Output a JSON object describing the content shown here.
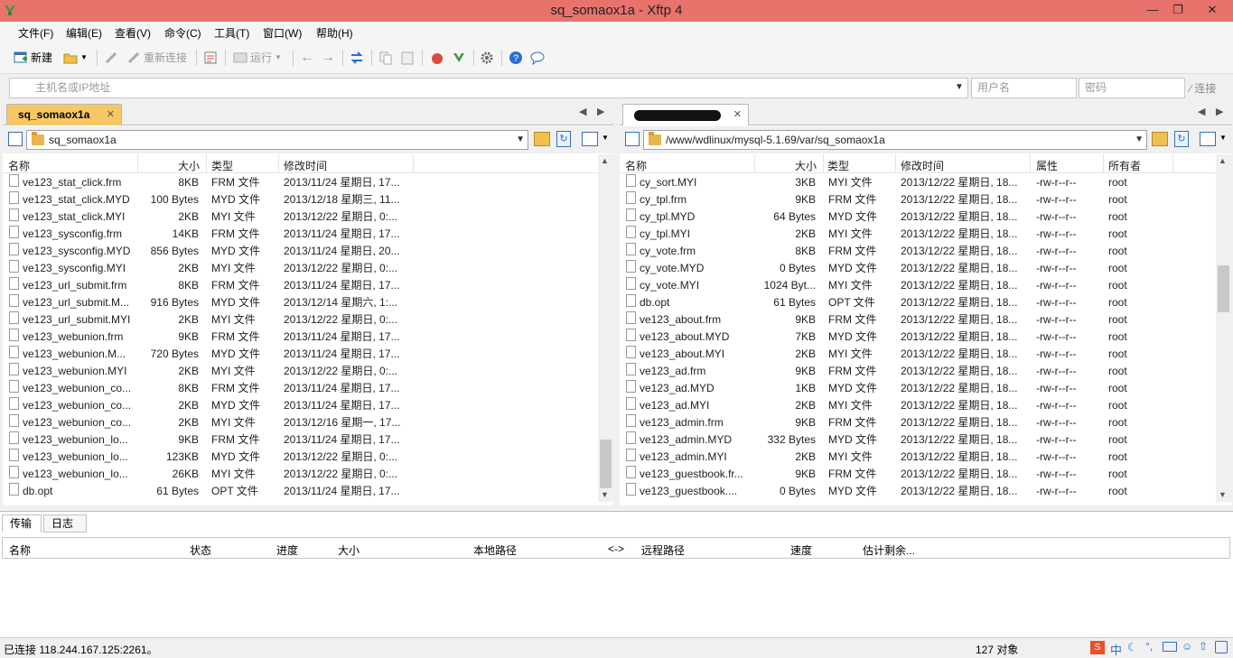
{
  "window": {
    "title": "sq_somaox1a - Xftp 4"
  },
  "menu": [
    "文件(F)",
    "编辑(E)",
    "查看(V)",
    "命令(C)",
    "工具(T)",
    "窗口(W)",
    "帮助(H)"
  ],
  "toolbar": {
    "new_label": "新建",
    "reconnect_label": "重新连接",
    "run_label": "运行"
  },
  "address": {
    "host_placeholder": "主机名或IP地址",
    "user_placeholder": "用户名",
    "password_placeholder": "密码",
    "connect_label": "连接"
  },
  "left": {
    "tab": "sq_somaox1a",
    "path": "sq_somaox1a",
    "columns": [
      "名称",
      "大小",
      "类型",
      "修改时间"
    ],
    "files": [
      [
        "ve123_stat_click.frm",
        "8KB",
        "FRM 文件",
        "2013/11/24 星期日, 17..."
      ],
      [
        "ve123_stat_click.MYD",
        "100 Bytes",
        "MYD 文件",
        "2013/12/18 星期三, 11..."
      ],
      [
        "ve123_stat_click.MYI",
        "2KB",
        "MYI 文件",
        "2013/12/22 星期日, 0:..."
      ],
      [
        "ve123_sysconfig.frm",
        "14KB",
        "FRM 文件",
        "2013/11/24 星期日, 17..."
      ],
      [
        "ve123_sysconfig.MYD",
        "856 Bytes",
        "MYD 文件",
        "2013/11/24 星期日, 20..."
      ],
      [
        "ve123_sysconfig.MYI",
        "2KB",
        "MYI 文件",
        "2013/12/22 星期日, 0:..."
      ],
      [
        "ve123_url_submit.frm",
        "8KB",
        "FRM 文件",
        "2013/11/24 星期日, 17..."
      ],
      [
        "ve123_url_submit.M...",
        "916 Bytes",
        "MYD 文件",
        "2013/12/14 星期六, 1:..."
      ],
      [
        "ve123_url_submit.MYI",
        "2KB",
        "MYI 文件",
        "2013/12/22 星期日, 0:..."
      ],
      [
        "ve123_webunion.frm",
        "9KB",
        "FRM 文件",
        "2013/11/24 星期日, 17..."
      ],
      [
        "ve123_webunion.M...",
        "720 Bytes",
        "MYD 文件",
        "2013/11/24 星期日, 17..."
      ],
      [
        "ve123_webunion.MYI",
        "2KB",
        "MYI 文件",
        "2013/12/22 星期日, 0:..."
      ],
      [
        "ve123_webunion_co...",
        "8KB",
        "FRM 文件",
        "2013/11/24 星期日, 17..."
      ],
      [
        "ve123_webunion_co...",
        "2KB",
        "MYD 文件",
        "2013/11/24 星期日, 17..."
      ],
      [
        "ve123_webunion_co...",
        "2KB",
        "MYI 文件",
        "2013/12/16 星期一, 17..."
      ],
      [
        "ve123_webunion_lo...",
        "9KB",
        "FRM 文件",
        "2013/11/24 星期日, 17..."
      ],
      [
        "ve123_webunion_lo...",
        "123KB",
        "MYD 文件",
        "2013/12/22 星期日, 0:..."
      ],
      [
        "ve123_webunion_lo...",
        "26KB",
        "MYI 文件",
        "2013/12/22 星期日, 0:..."
      ],
      [
        "db.opt",
        "61 Bytes",
        "OPT 文件",
        "2013/11/24 星期日, 17..."
      ]
    ]
  },
  "right": {
    "path": "/www/wdlinux/mysql-5.1.69/var/sq_somaox1a",
    "columns": [
      "名称",
      "大小",
      "类型",
      "修改时间",
      "属性",
      "所有者"
    ],
    "files": [
      [
        "cy_sort.MYI",
        "3KB",
        "MYI 文件",
        "2013/12/22 星期日, 18...",
        "-rw-r--r--",
        "root"
      ],
      [
        "cy_tpl.frm",
        "9KB",
        "FRM 文件",
        "2013/12/22 星期日, 18...",
        "-rw-r--r--",
        "root"
      ],
      [
        "cy_tpl.MYD",
        "64 Bytes",
        "MYD 文件",
        "2013/12/22 星期日, 18...",
        "-rw-r--r--",
        "root"
      ],
      [
        "cy_tpl.MYI",
        "2KB",
        "MYI 文件",
        "2013/12/22 星期日, 18...",
        "-rw-r--r--",
        "root"
      ],
      [
        "cy_vote.frm",
        "8KB",
        "FRM 文件",
        "2013/12/22 星期日, 18...",
        "-rw-r--r--",
        "root"
      ],
      [
        "cy_vote.MYD",
        "0 Bytes",
        "MYD 文件",
        "2013/12/22 星期日, 18...",
        "-rw-r--r--",
        "root"
      ],
      [
        "cy_vote.MYI",
        "1024 Byt...",
        "MYI 文件",
        "2013/12/22 星期日, 18...",
        "-rw-r--r--",
        "root"
      ],
      [
        "db.opt",
        "61 Bytes",
        "OPT 文件",
        "2013/12/22 星期日, 18...",
        "-rw-r--r--",
        "root"
      ],
      [
        "ve123_about.frm",
        "9KB",
        "FRM 文件",
        "2013/12/22 星期日, 18...",
        "-rw-r--r--",
        "root"
      ],
      [
        "ve123_about.MYD",
        "7KB",
        "MYD 文件",
        "2013/12/22 星期日, 18...",
        "-rw-r--r--",
        "root"
      ],
      [
        "ve123_about.MYI",
        "2KB",
        "MYI 文件",
        "2013/12/22 星期日, 18...",
        "-rw-r--r--",
        "root"
      ],
      [
        "ve123_ad.frm",
        "9KB",
        "FRM 文件",
        "2013/12/22 星期日, 18...",
        "-rw-r--r--",
        "root"
      ],
      [
        "ve123_ad.MYD",
        "1KB",
        "MYD 文件",
        "2013/12/22 星期日, 18...",
        "-rw-r--r--",
        "root"
      ],
      [
        "ve123_ad.MYI",
        "2KB",
        "MYI 文件",
        "2013/12/22 星期日, 18...",
        "-rw-r--r--",
        "root"
      ],
      [
        "ve123_admin.frm",
        "9KB",
        "FRM 文件",
        "2013/12/22 星期日, 18...",
        "-rw-r--r--",
        "root"
      ],
      [
        "ve123_admin.MYD",
        "332 Bytes",
        "MYD 文件",
        "2013/12/22 星期日, 18...",
        "-rw-r--r--",
        "root"
      ],
      [
        "ve123_admin.MYI",
        "2KB",
        "MYI 文件",
        "2013/12/22 星期日, 18...",
        "-rw-r--r--",
        "root"
      ],
      [
        "ve123_guestbook.fr...",
        "9KB",
        "FRM 文件",
        "2013/12/22 星期日, 18...",
        "-rw-r--r--",
        "root"
      ],
      [
        "ve123_guestbook....",
        "0 Bytes",
        "MYD 文件",
        "2013/12/22 星期日, 18...",
        "-rw-r--r--",
        "root"
      ]
    ]
  },
  "bottom": {
    "tabs": [
      "传输",
      "日志"
    ],
    "columns": [
      "名称",
      "状态",
      "进度",
      "大小",
      "本地路径",
      "<->",
      "远程路径",
      "速度",
      "估计剩余..."
    ]
  },
  "status": {
    "connection": "已连接 118.244.167.125:2261。",
    "count": "127 对象",
    "ime": "中"
  },
  "colors": {
    "titlebar": "#e8726c",
    "active_tab": "#f7c766"
  }
}
